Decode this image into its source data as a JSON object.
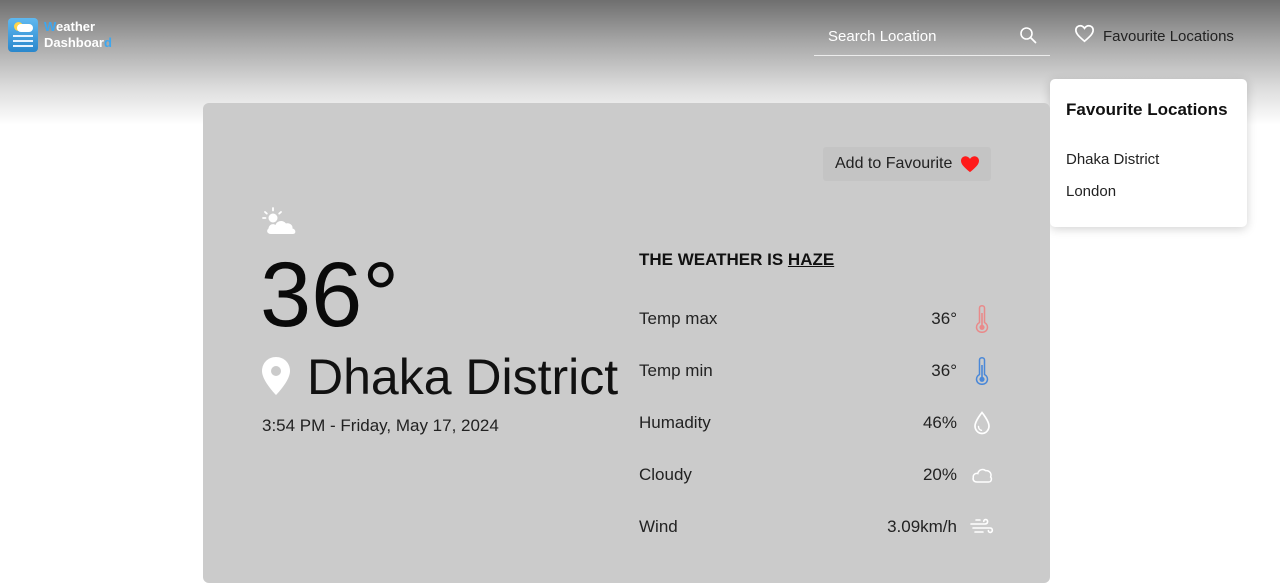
{
  "app": {
    "logo_line1": "Weather",
    "logo_line2": "Dashboard",
    "accent": "#3da7f0"
  },
  "header": {
    "search_placeholder": "Search Location",
    "favourites_link": "Favourite Locations"
  },
  "favourites_menu": {
    "title": "Favourite Locations",
    "items": [
      "Dhaka District",
      "London"
    ]
  },
  "card": {
    "add_favourite_label": "Add to Favourite",
    "temperature": "36°",
    "location": "Dhaka District",
    "datetime": "3:54 PM - Friday, May 17, 2024",
    "condition_prefix": "THE WEATHER IS",
    "condition": "HAZE",
    "details": [
      {
        "label": "Temp max",
        "value": "36°",
        "icon": "thermometer-hot-icon"
      },
      {
        "label": "Temp min",
        "value": "36°",
        "icon": "thermometer-cold-icon"
      },
      {
        "label": "Humadity",
        "value": "46%",
        "icon": "droplet-icon"
      },
      {
        "label": "Cloudy",
        "value": "20%",
        "icon": "cloud-icon"
      },
      {
        "label": "Wind",
        "value": "3.09km/h",
        "icon": "wind-icon"
      }
    ]
  },
  "colors": {
    "heart": "#ff1a1a",
    "temp_max_icon": "#e98a8a",
    "temp_min_icon": "#4a88d8"
  }
}
